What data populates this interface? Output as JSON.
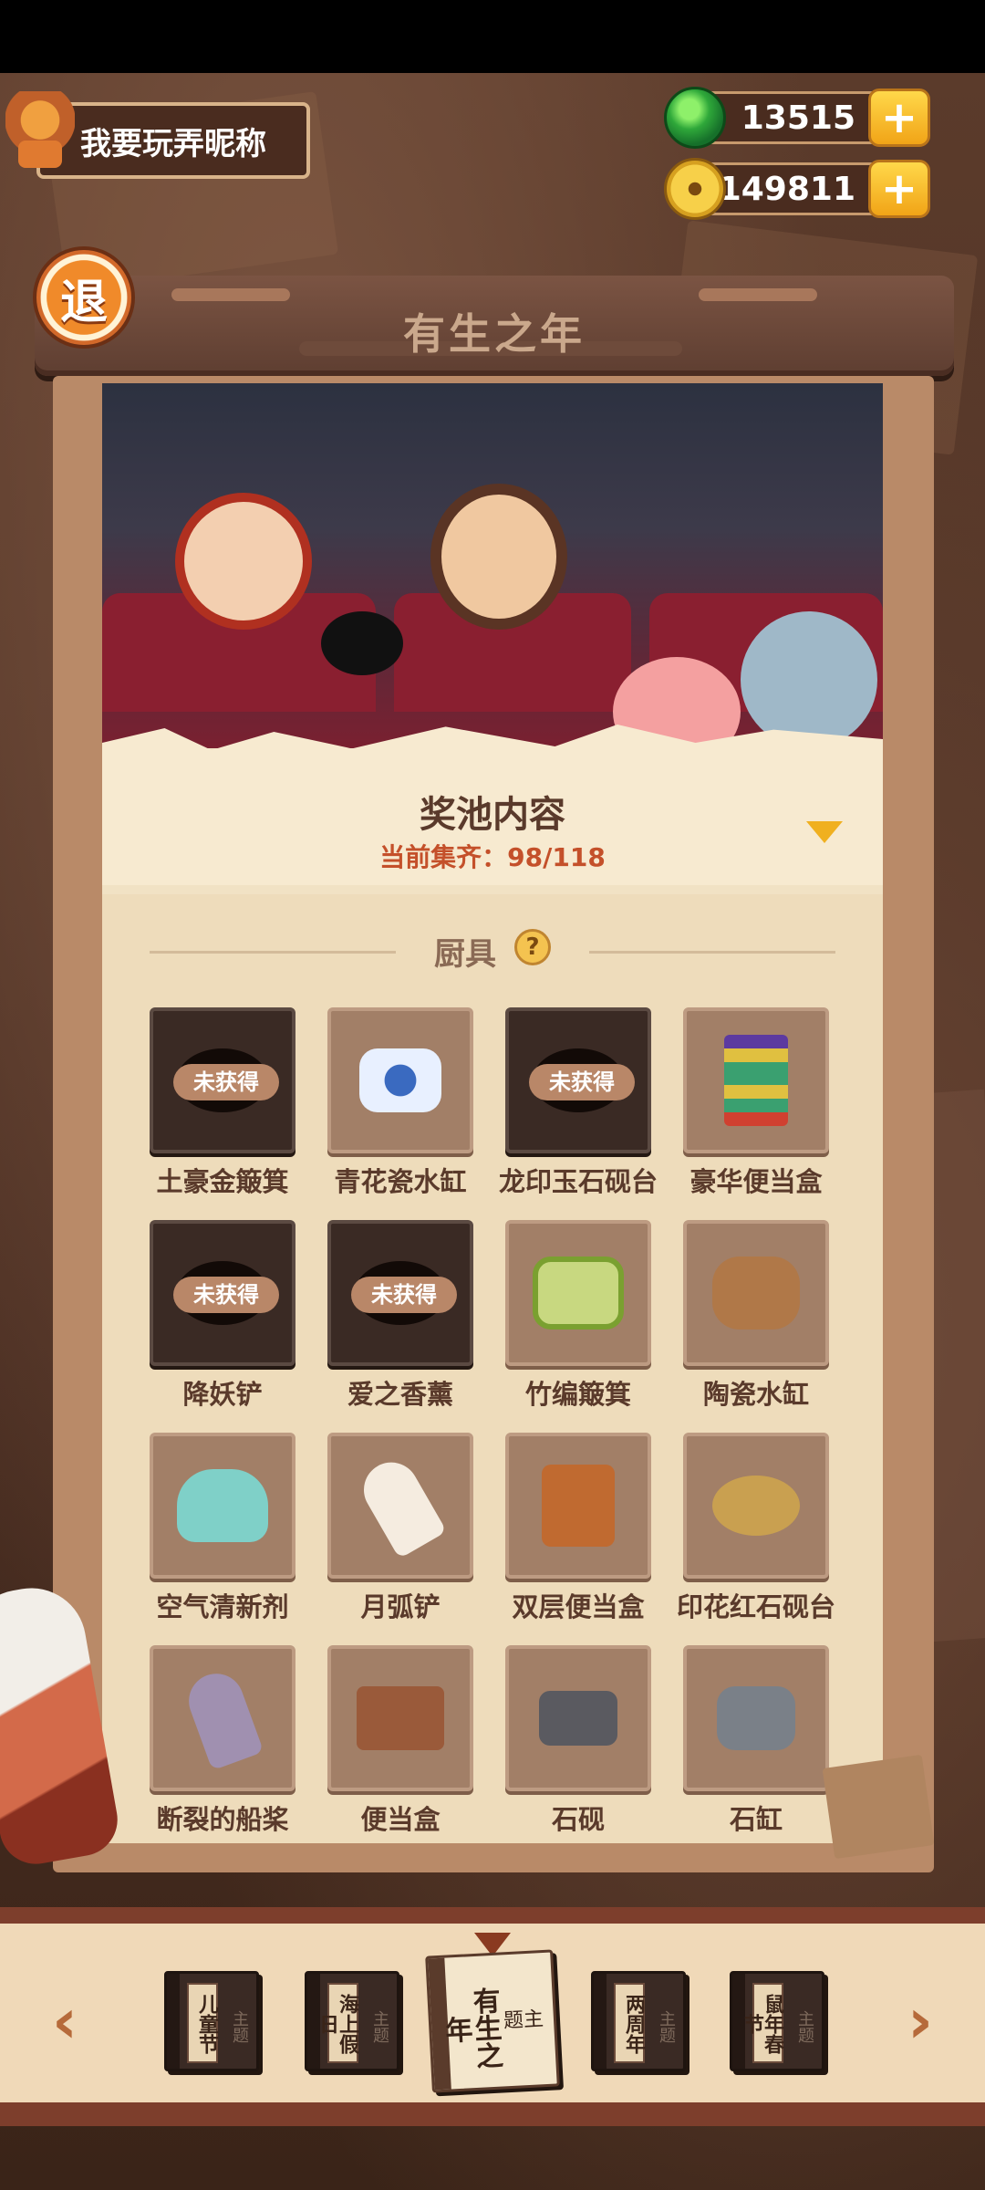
{
  "player": {
    "nickname": "我要玩弄昵称"
  },
  "currency": {
    "jade": {
      "value": "13515",
      "icon": "jade-icon"
    },
    "coin": {
      "value": "149811",
      "icon": "coin-icon"
    },
    "plus_label": "+"
  },
  "exit_label": "退",
  "page_title": "有生之年",
  "pool": {
    "title": "奖池内容",
    "progress": "当前集齐：98/118"
  },
  "section": {
    "title": "厨具",
    "help_label": "?",
    "locked_label": "未获得",
    "items": [
      {
        "name": "土豪金簸箕",
        "locked": true
      },
      {
        "name": "青花瓷水缸",
        "locked": false
      },
      {
        "name": "龙印玉石砚台",
        "locked": true
      },
      {
        "name": "豪华便当盒",
        "locked": false
      },
      {
        "name": "降妖铲",
        "locked": true
      },
      {
        "name": "爱之香薰",
        "locked": true
      },
      {
        "name": "竹编簸箕",
        "locked": false
      },
      {
        "name": "陶瓷水缸",
        "locked": false
      },
      {
        "name": "空气清新剂",
        "locked": false
      },
      {
        "name": "月弧铲",
        "locked": false
      },
      {
        "name": "双层便当盒",
        "locked": false
      },
      {
        "name": "印花红石砚台",
        "locked": false
      },
      {
        "name": "断裂的船桨",
        "locked": false
      },
      {
        "name": "便当盒",
        "locked": false
      },
      {
        "name": "石砚",
        "locked": false
      },
      {
        "name": "石缸",
        "locked": false
      }
    ]
  },
  "themes": {
    "prev": "‹",
    "next": "›",
    "books": [
      {
        "label": "儿童节",
        "stamp": "主题"
      },
      {
        "label": "海上假日",
        "stamp": "主题"
      },
      {
        "label": "有生之年",
        "stamp": "主题",
        "active": true
      },
      {
        "label": "两周年",
        "stamp": "主题"
      },
      {
        "label": "鼠年春节",
        "stamp": "主题"
      }
    ]
  },
  "colors": {
    "accent": "#f1a417",
    "progress_red": "#c4502a",
    "panel": "#f1e2c4"
  }
}
